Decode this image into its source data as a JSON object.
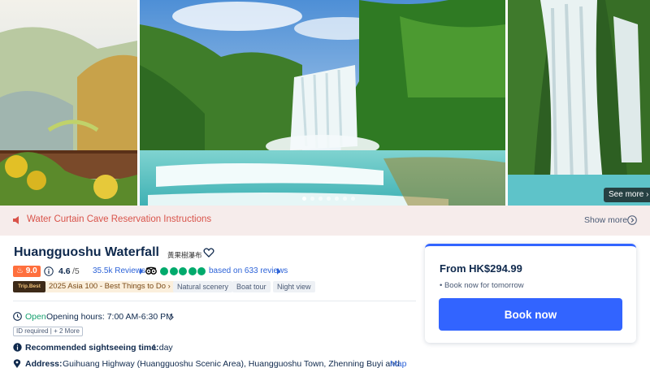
{
  "gallery": {
    "photo_count": 7,
    "active_photo": 1,
    "see_more_label": "See more"
  },
  "notice": {
    "text": "Water Curtain Cave Reservation Instructions",
    "show_more_label": "Show more",
    "color": "#d9534a"
  },
  "attraction": {
    "name": "Huangguoshu Waterfall",
    "local_name": "黃果樹瀑布",
    "score": "9.0",
    "rating": "4.6",
    "rating_max": "/5",
    "reviews_label": "35.5k Reviews",
    "tripadvisor_bubbles": 5,
    "tripadvisor_text": "based on 633 reviews",
    "trip_best_logo": "Trip.Best",
    "trip_best_text": "2025 Asia 100 - Best Things to Do",
    "tags": [
      "Natural scenery",
      "Boat tour",
      "Night view"
    ]
  },
  "details": {
    "open_status": "Open",
    "opening_hours": "Opening hours: 7:00 AM-6:30 PM",
    "id_tag": "ID required | + 2 More",
    "recommended_label": "Recommended sightseeing time:",
    "recommended_value": "1 day",
    "address_label": "Address:",
    "address_value": "Guihuang Highway (Huangguoshu Scenic Area), Huangguoshu Town, Zhenning Buyi and",
    "map_label": "Map"
  },
  "booking": {
    "price": "From HK$294.99",
    "note": "Book now for tomorrow",
    "button_label": "Book now",
    "accent": "#3264ff"
  }
}
